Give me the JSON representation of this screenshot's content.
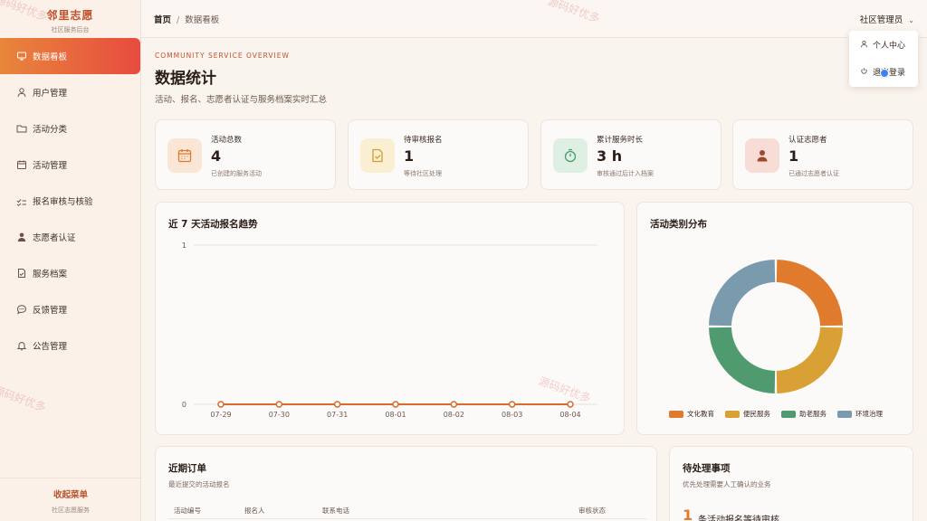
{
  "sidebar": {
    "brand_title": "邻里志愿",
    "brand_sub": "社区服务后台",
    "items": [
      {
        "label": "数据看板",
        "icon": "dashboard-icon",
        "active": true
      },
      {
        "label": "用户管理",
        "icon": "user-icon"
      },
      {
        "label": "活动分类",
        "icon": "folder-icon"
      },
      {
        "label": "活动管理",
        "icon": "calendar-icon"
      },
      {
        "label": "报名审核与核验",
        "icon": "checklist-icon"
      },
      {
        "label": "志愿者认证",
        "icon": "person-icon"
      },
      {
        "label": "服务档案",
        "icon": "document-check-icon"
      },
      {
        "label": "反馈管理",
        "icon": "chat-icon"
      },
      {
        "label": "公告管理",
        "icon": "bell-icon"
      }
    ],
    "collapse_label": "收起菜单",
    "footer_sub": "社区志愿服务"
  },
  "topbar": {
    "breadcrumb_home": "首页",
    "breadcrumb_sep": "/",
    "breadcrumb_current": "数据看板",
    "user_name": "社区管理员",
    "dropdown": [
      {
        "label": "个人中心",
        "icon": "user-icon"
      },
      {
        "label": "退出登录",
        "icon": "power-icon"
      }
    ]
  },
  "header": {
    "kicker": "COMMUNITY SERVICE OVERVIEW",
    "title": "数据统计",
    "subtitle": "活动、报名、志愿者认证与服务档案实时汇总"
  },
  "stats": [
    {
      "label": "活动总数",
      "value": "4",
      "note": "已创建的服务活动",
      "icon": "calendar-icon",
      "color": "#e07a2c",
      "bg": "#fbe6d6"
    },
    {
      "label": "待审核报名",
      "value": "1",
      "note": "等待社区处理",
      "icon": "document-check-icon",
      "color": "#d39b2f",
      "bg": "#fbefd3"
    },
    {
      "label": "累计服务时长",
      "value": "3 h",
      "note": "审核通过后计入档案",
      "icon": "timer-icon",
      "color": "#4a9a6c",
      "bg": "#def0e3"
    },
    {
      "label": "认证志愿者",
      "value": "1",
      "note": "已通过志愿者认证",
      "icon": "person-icon",
      "color": "#a2452f",
      "bg": "#f7ddd5"
    }
  ],
  "trend": {
    "title": "近 7 天活动报名趋势"
  },
  "donut": {
    "title": "活动类别分布"
  },
  "orders": {
    "title": "近期订单",
    "subtitle": "最近提交的活动报名",
    "columns": [
      "活动编号",
      "报名人",
      "联系电话",
      "审核状态"
    ]
  },
  "todo": {
    "title": "待处理事项",
    "subtitle": "优先处理需要人工确认的业务",
    "count": "1",
    "text": "条活动报名等待审核"
  },
  "watermark": "源码好优多",
  "chart_data": [
    {
      "type": "line",
      "title": "近 7 天活动报名趋势",
      "x": [
        "07-29",
        "07-30",
        "07-31",
        "08-01",
        "08-02",
        "08-03",
        "08-04"
      ],
      "series": [
        {
          "values": [
            0,
            0,
            0,
            0,
            0,
            0,
            0
          ],
          "color": "#d9692c"
        }
      ],
      "ylim": [
        0,
        1
      ],
      "yticks": [
        0,
        1
      ],
      "grid": true
    },
    {
      "type": "pie",
      "title": "活动类别分布",
      "categories": [
        "文化教育",
        "便民服务",
        "助老服务",
        "环境治理"
      ],
      "values": [
        1,
        1,
        1,
        1
      ],
      "colors": [
        "#e07a2c",
        "#d9a036",
        "#4f9a6e",
        "#7a9aae"
      ],
      "legend": "bottom"
    }
  ]
}
